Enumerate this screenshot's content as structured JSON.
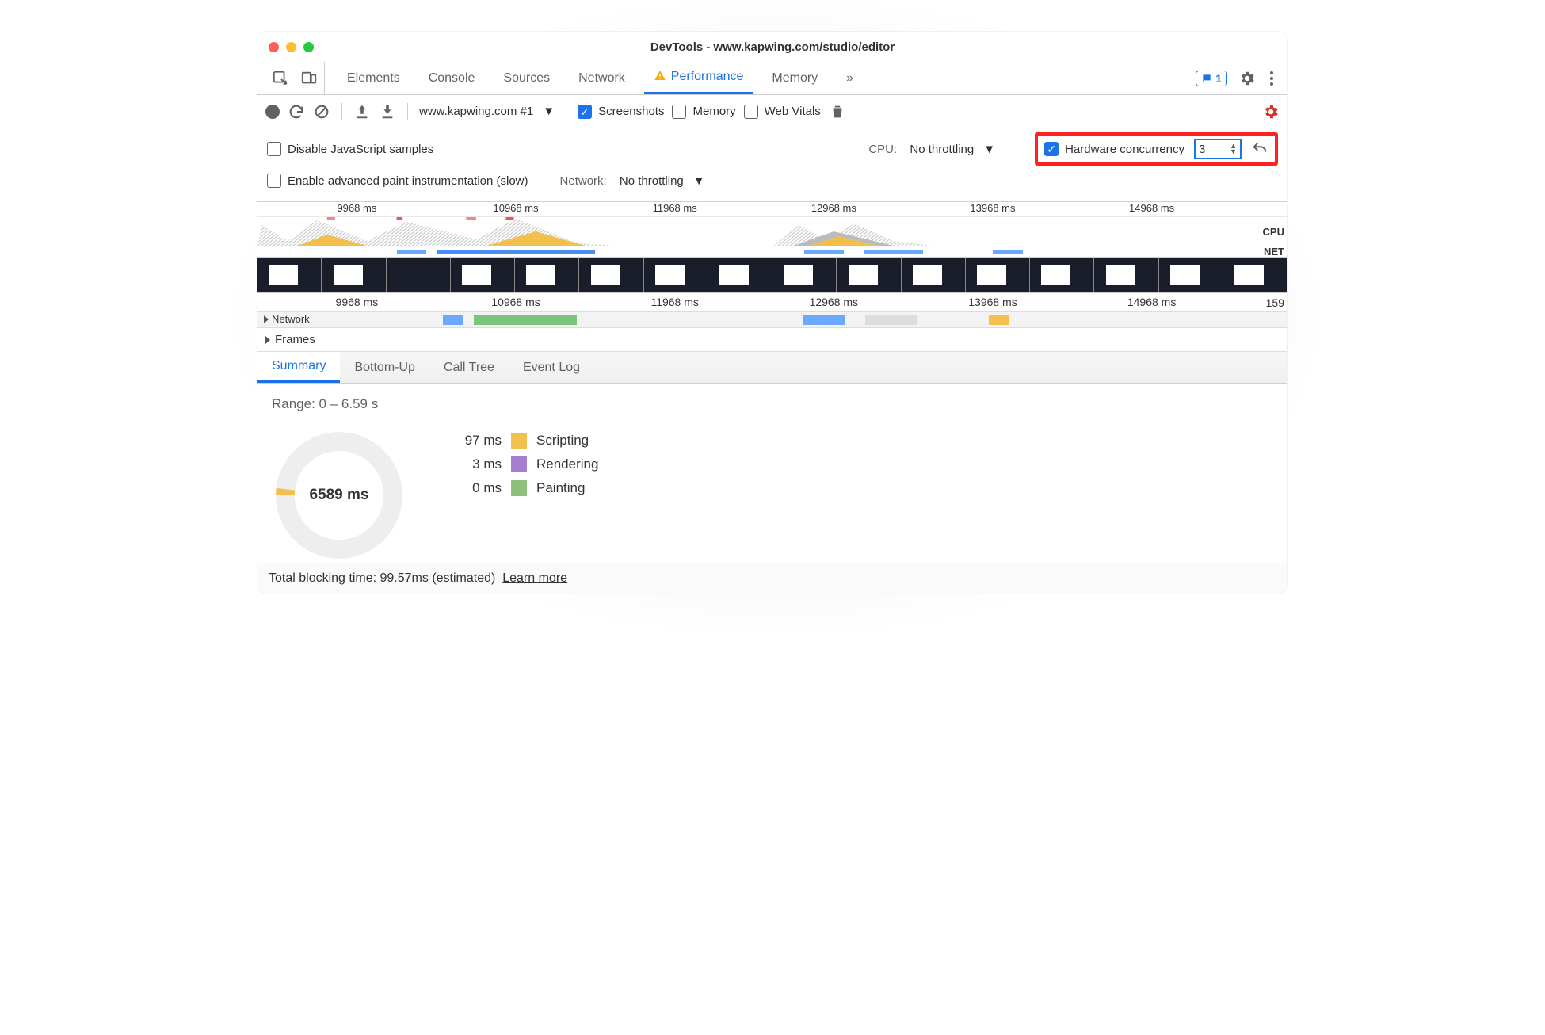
{
  "window_title": "DevTools - www.kapwing.com/studio/editor",
  "tabs": {
    "items": [
      "Elements",
      "Console",
      "Sources",
      "Network",
      "Performance",
      "Memory"
    ],
    "active": "Performance",
    "badge_count": "1"
  },
  "toolbar": {
    "target": "www.kapwing.com #1",
    "screenshots_label": "Screenshots",
    "screenshots_checked": true,
    "memory_label": "Memory",
    "memory_checked": false,
    "webvitals_label": "Web Vitals",
    "webvitals_checked": false
  },
  "options": {
    "disable_js_samples_label": "Disable JavaScript samples",
    "disable_js_samples_checked": false,
    "cpu_label": "CPU:",
    "cpu_value": "No throttling",
    "hardware_concurrency_label": "Hardware concurrency",
    "hardware_concurrency_checked": true,
    "hardware_concurrency_value": "3",
    "enable_paint_label": "Enable advanced paint instrumentation (slow)",
    "enable_paint_checked": false,
    "network_label": "Network:",
    "network_value": "No throttling"
  },
  "overview": {
    "ticks": [
      "9968 ms",
      "10968 ms",
      "11968 ms",
      "12968 ms",
      "13968 ms",
      "14968 ms"
    ],
    "cpu_label": "CPU",
    "net_label": "NET"
  },
  "detail": {
    "ticks": [
      "9968 ms",
      "10968 ms",
      "11968 ms",
      "12968 ms",
      "13968 ms",
      "14968 ms"
    ],
    "end_tick": "159",
    "frames_label": "Frames",
    "network_label": "Network"
  },
  "summary_tabs": [
    "Summary",
    "Bottom-Up",
    "Call Tree",
    "Event Log"
  ],
  "summary_active": "Summary",
  "summary": {
    "range_label": "Range: 0 – 6.59 s",
    "total_ms": "6589 ms",
    "legend": [
      {
        "ms": "97 ms",
        "name": "Scripting",
        "color": "#f4c04d"
      },
      {
        "ms": "3 ms",
        "name": "Rendering",
        "color": "#a87fd0"
      },
      {
        "ms": "0 ms",
        "name": "Painting",
        "color": "#8fbf7a"
      }
    ]
  },
  "footer": {
    "blocking_time_label": "Total blocking time: 99.57ms (estimated)",
    "learn_more": "Learn more"
  },
  "colors": {
    "accent": "#1a73e8",
    "danger": "#d93025",
    "scripting": "#f4c04d",
    "rendering": "#a87fd0",
    "painting": "#8fbf7a"
  }
}
